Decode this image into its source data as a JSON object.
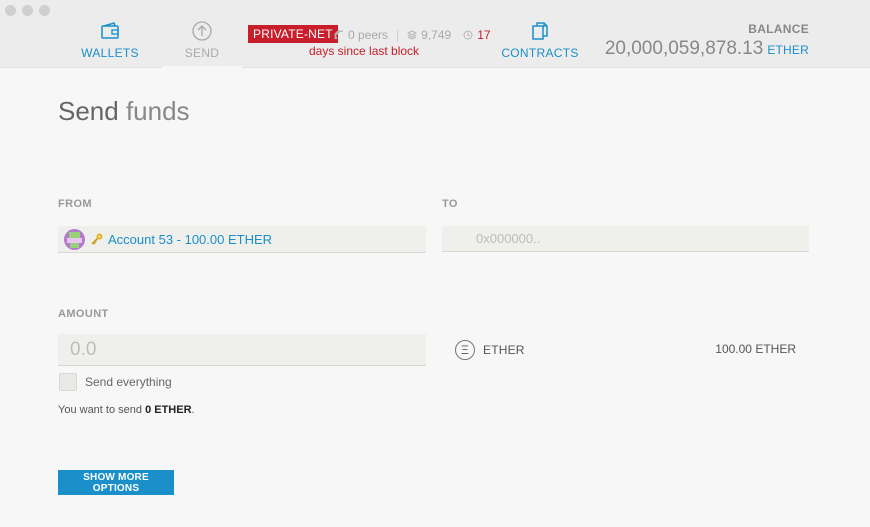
{
  "header": {
    "nav": {
      "wallets": "WALLETS",
      "send": "SEND",
      "contracts": "CONTRACTS"
    },
    "network": {
      "badge": "PRIVATE-NET",
      "peers": "0 peers",
      "block": "9,749",
      "days": "17",
      "days_label": "days since last block"
    },
    "balance": {
      "label": "BALANCE",
      "value": "20,000,059,878.13",
      "unit": "ETHER"
    }
  },
  "page": {
    "title_bold": "Send",
    "title_light": " funds"
  },
  "form": {
    "from_label": "FROM",
    "from_account": "Account 53 - 100.00 ETHER",
    "to_label": "TO",
    "to_placeholder": "0x000000..",
    "amount_label": "AMOUNT",
    "amount_placeholder": "0.0",
    "currency_symbol": "Ξ",
    "currency": "ETHER",
    "currency_balance": "100.00 ETHER",
    "send_everything": "Send everything",
    "summary_prefix": "You want to send ",
    "summary_amount": "0 ETHER",
    "summary_suffix": "."
  },
  "buttons": {
    "more_options": "SHOW MORE OPTIONS"
  },
  "colors": {
    "accent": "#1a8fc9",
    "network_red": "#c81d2a",
    "background": "#f7f7f7"
  },
  "icons": {
    "wallets": "wallet-icon",
    "send": "arrow-up-circle-icon",
    "contracts": "documents-icon",
    "peers": "signal-icon",
    "block": "layers-icon",
    "days": "clock-icon",
    "key": "key-icon"
  }
}
